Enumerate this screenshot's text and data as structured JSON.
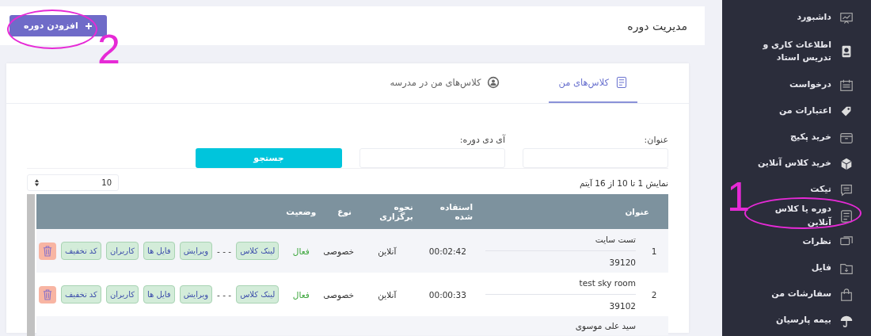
{
  "sidebar": {
    "items": [
      {
        "label": "داشبورد"
      },
      {
        "label": "اطلاعات کاری و تدریس استاد"
      },
      {
        "label": "درخواست"
      },
      {
        "label": "اعتبارات من"
      },
      {
        "label": "خرید پکیج"
      },
      {
        "label": "خرید کلاس آنلاین"
      },
      {
        "label": "تیکت"
      },
      {
        "label": "دوره یا کلاس آنلاین"
      },
      {
        "label": "نظرات"
      },
      {
        "label": "فایل"
      },
      {
        "label": "سفارشات من"
      },
      {
        "label": "بیمه پارسیان"
      }
    ]
  },
  "header": {
    "title": "مدیریت دوره",
    "add_button": "افزودن دوره"
  },
  "tabs": [
    {
      "label": "کلاس‌های من",
      "selected": true
    },
    {
      "label": "کلاس‌های من در مدرسه",
      "selected": false
    }
  ],
  "filters": {
    "fields": [
      {
        "label": "عنوان:"
      },
      {
        "label": "آی دی دوره:"
      }
    ],
    "search_button": "جستجو"
  },
  "info": "نمایش 1 تا 10 از 16 آیتم",
  "page_size": "10",
  "table": {
    "columns": [
      "عنوان",
      "استفاده شده",
      "نحوه برگزاری",
      "نوع",
      "وضعیت"
    ],
    "rows": [
      {
        "index": "1",
        "title": "تست سایت",
        "id": "39120",
        "used": "00:02:42",
        "mode": "آنلاین",
        "type": "خصوصی",
        "status": "فعال",
        "link": "لینک کلاس",
        "dash": "- - -",
        "actions": [
          "ویرایش",
          "فایل ها",
          "کاربران",
          "کد تخفیف"
        ]
      },
      {
        "index": "2",
        "title": "test sky room",
        "id": "39102",
        "used": "00:00:33",
        "mode": "آنلاین",
        "type": "خصوصی",
        "status": "فعال",
        "link": "لینک کلاس",
        "dash": "- - -",
        "actions": [
          "ویرایش",
          "فایل ها",
          "کاربران",
          "کد تخفیف"
        ]
      },
      {
        "title": "سید علی موسوی"
      }
    ]
  },
  "annotations": [
    "1",
    "2"
  ]
}
